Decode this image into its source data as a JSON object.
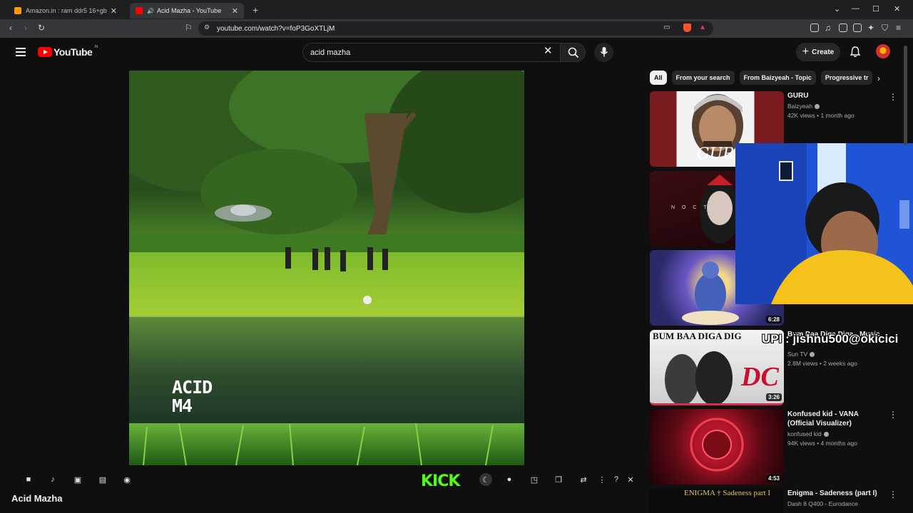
{
  "browser": {
    "tabs": [
      {
        "title": "Amazon.in : ram ddr5 16+gb",
        "active": false,
        "favicon_color": "#ff9900"
      },
      {
        "title": "Acid Mazha - YouTube",
        "active": true,
        "favicon_color": "#ff0000"
      }
    ],
    "url": "youtube.com/watch?v=foP3GoXTLjM"
  },
  "header": {
    "logo_text": "YouTube",
    "region": "IN",
    "search_value": "acid mazha",
    "create_label": "Create"
  },
  "player": {
    "overlay_logo_line1": "ACID",
    "overlay_logo_line2": "M4",
    "kick_label": "KICK",
    "video_title": "Acid Mazha"
  },
  "chips": [
    "All",
    "From your search",
    "From Baizyeah - Topic",
    "Progressive tr"
  ],
  "recommendations": [
    {
      "title": "GURU",
      "channel": "Baizyeah",
      "verified": true,
      "meta": "42K views • 1 month ago",
      "duration": ""
    },
    {
      "title": "",
      "channel": "",
      "verified": false,
      "meta": "",
      "duration": ""
    },
    {
      "title": "",
      "channel": "",
      "verified": false,
      "meta": "",
      "duration": "6:28"
    },
    {
      "title": "Bum Baa Diga Diga - Music",
      "channel": "Sun TV",
      "verified": true,
      "meta": "2.8M views • 2 weeks ago",
      "duration": "3:26"
    },
    {
      "title": "Konfused kid - VANA (Official Visualizer)",
      "channel": "konfused kid",
      "verified": true,
      "meta": "94K views • 4 months ago",
      "duration": "4:53"
    },
    {
      "title": "Enigma - Sadeness (part I)",
      "channel": "Dash 8 Q400 - Eurodance",
      "verified": false,
      "meta": "",
      "duration": ""
    }
  ],
  "thumb_text": {
    "guru": "GURU",
    "noct": "N O C T",
    "bum": "BUM BAA DIGA DIG",
    "enigma": "ENIGMA † Sadeness part I"
  },
  "stream_overlay": {
    "upi_text": "UPI : jishnu500@okicici"
  }
}
